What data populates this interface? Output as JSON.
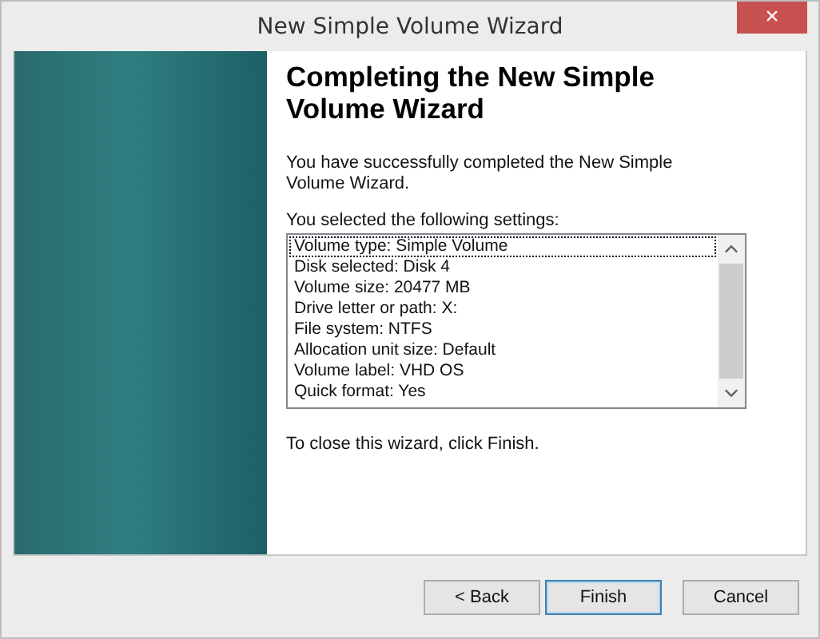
{
  "window": {
    "title": "New Simple Volume Wizard",
    "close": "×"
  },
  "page": {
    "heading": "Completing the New Simple Volume Wizard",
    "intro": "You have successfully completed the New Simple Volume Wizard.",
    "settings_label": "You selected the following settings:",
    "settings": [
      {
        "text": "Volume type: Simple Volume",
        "focused": true
      },
      {
        "text": "Disk selected: Disk 4",
        "focused": false
      },
      {
        "text": "Volume size: 20477 MB",
        "focused": false
      },
      {
        "text": "Drive letter or path: X:",
        "focused": false
      },
      {
        "text": "File system: NTFS",
        "focused": false
      },
      {
        "text": "Allocation unit size: Default",
        "focused": false
      },
      {
        "text": "Volume label: VHD OS",
        "focused": false
      },
      {
        "text": "Quick format: Yes",
        "focused": false
      }
    ],
    "closing": "To close this wizard, click Finish."
  },
  "buttons": [
    {
      "label": "< Back",
      "default": false
    },
    {
      "label": "Finish",
      "default": true
    },
    {
      "label": "Cancel",
      "default": false
    }
  ]
}
